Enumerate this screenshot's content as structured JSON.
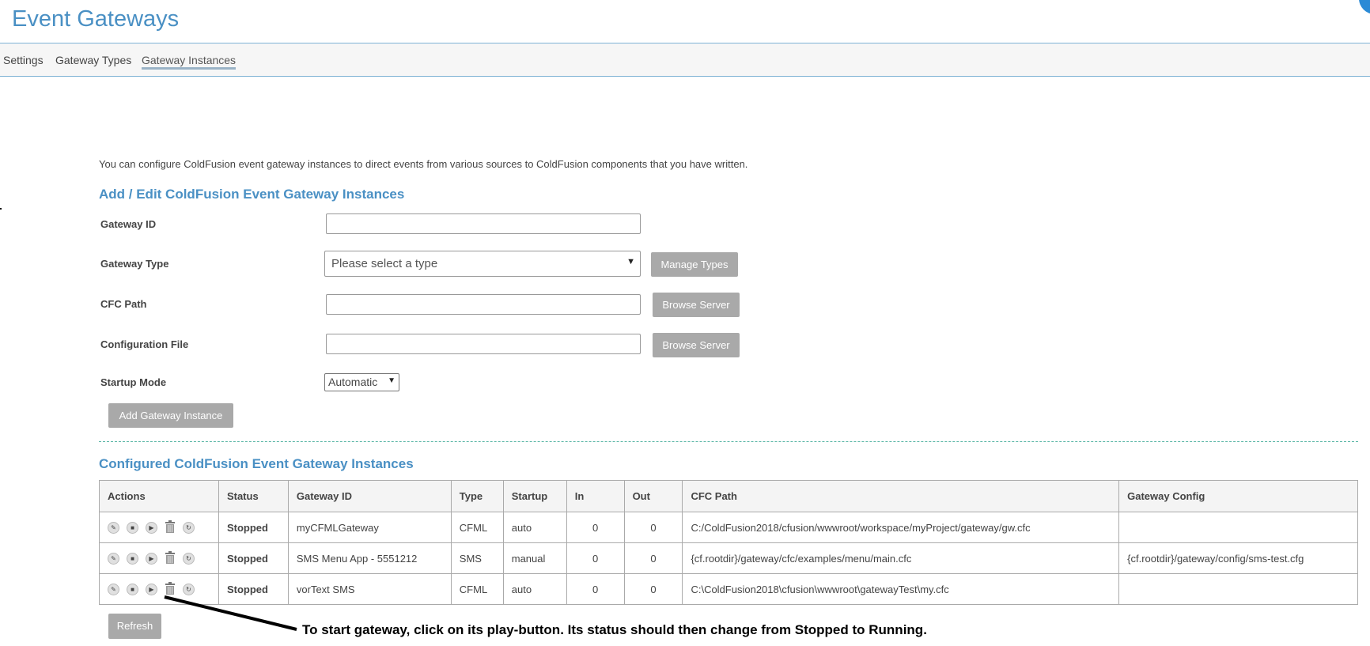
{
  "header": {
    "title": "Event Gateways"
  },
  "tabs": [
    {
      "label": "Settings"
    },
    {
      "label": "Gateway Types"
    },
    {
      "label": "Gateway Instances",
      "active": true
    }
  ],
  "intro": "You can configure ColdFusion event gateway instances to direct events from various sources to ColdFusion components that you have written.",
  "form": {
    "title": "Add / Edit ColdFusion Event Gateway Instances",
    "gateway_id_label": "Gateway ID",
    "gateway_id_value": "",
    "gateway_type_label": "Gateway Type",
    "gateway_type_selected": "Please select a type",
    "manage_types_button": "Manage Types",
    "cfc_path_label": "CFC Path",
    "cfc_path_value": "",
    "browse_server_button": "Browse Server",
    "config_file_label": "Configuration File",
    "config_file_value": "",
    "browse_server_button2": "Browse Server",
    "startup_mode_label": "Startup Mode",
    "startup_mode_selected": "Automatic",
    "add_button": "Add Gateway Instance"
  },
  "configured": {
    "title": "Configured ColdFusion Event Gateway Instances",
    "columns": [
      "Actions",
      "Status",
      "Gateway ID",
      "Type",
      "Startup",
      "In",
      "Out",
      "CFC Path",
      "Gateway Config"
    ],
    "rows": [
      {
        "status": "Stopped",
        "gateway_id": "myCFMLGateway",
        "type": "CFML",
        "startup": "auto",
        "in": "0",
        "out": "0",
        "cfc_path": "C:/ColdFusion2018/cfusion/wwwroot/workspace/myProject/gateway/gw.cfc",
        "config": ""
      },
      {
        "status": "Stopped",
        "gateway_id": "SMS Menu App - 5551212",
        "type": "SMS",
        "startup": "manual",
        "in": "0",
        "out": "0",
        "cfc_path": "{cf.rootdir}/gateway/cfc/examples/menu/main.cfc",
        "config": "{cf.rootdir}/gateway/config/sms-test.cfg"
      },
      {
        "status": "Stopped",
        "gateway_id": "vorText SMS",
        "type": "CFML",
        "startup": "auto",
        "in": "0",
        "out": "0",
        "cfc_path": "C:\\ColdFusion2018\\cfusion\\wwwroot\\gatewayTest\\my.cfc",
        "config": ""
      }
    ],
    "refresh_button": "Refresh"
  },
  "annotation": "To start gateway, click on its play-button. Its status should then change from Stopped to Running.",
  "colors": {
    "accent": "#4a90c4",
    "button": "#a9a9a9",
    "divider": "#5fb8a8"
  },
  "icons": [
    "edit-icon",
    "stop-icon",
    "play-icon",
    "delete-icon",
    "restart-icon"
  ]
}
